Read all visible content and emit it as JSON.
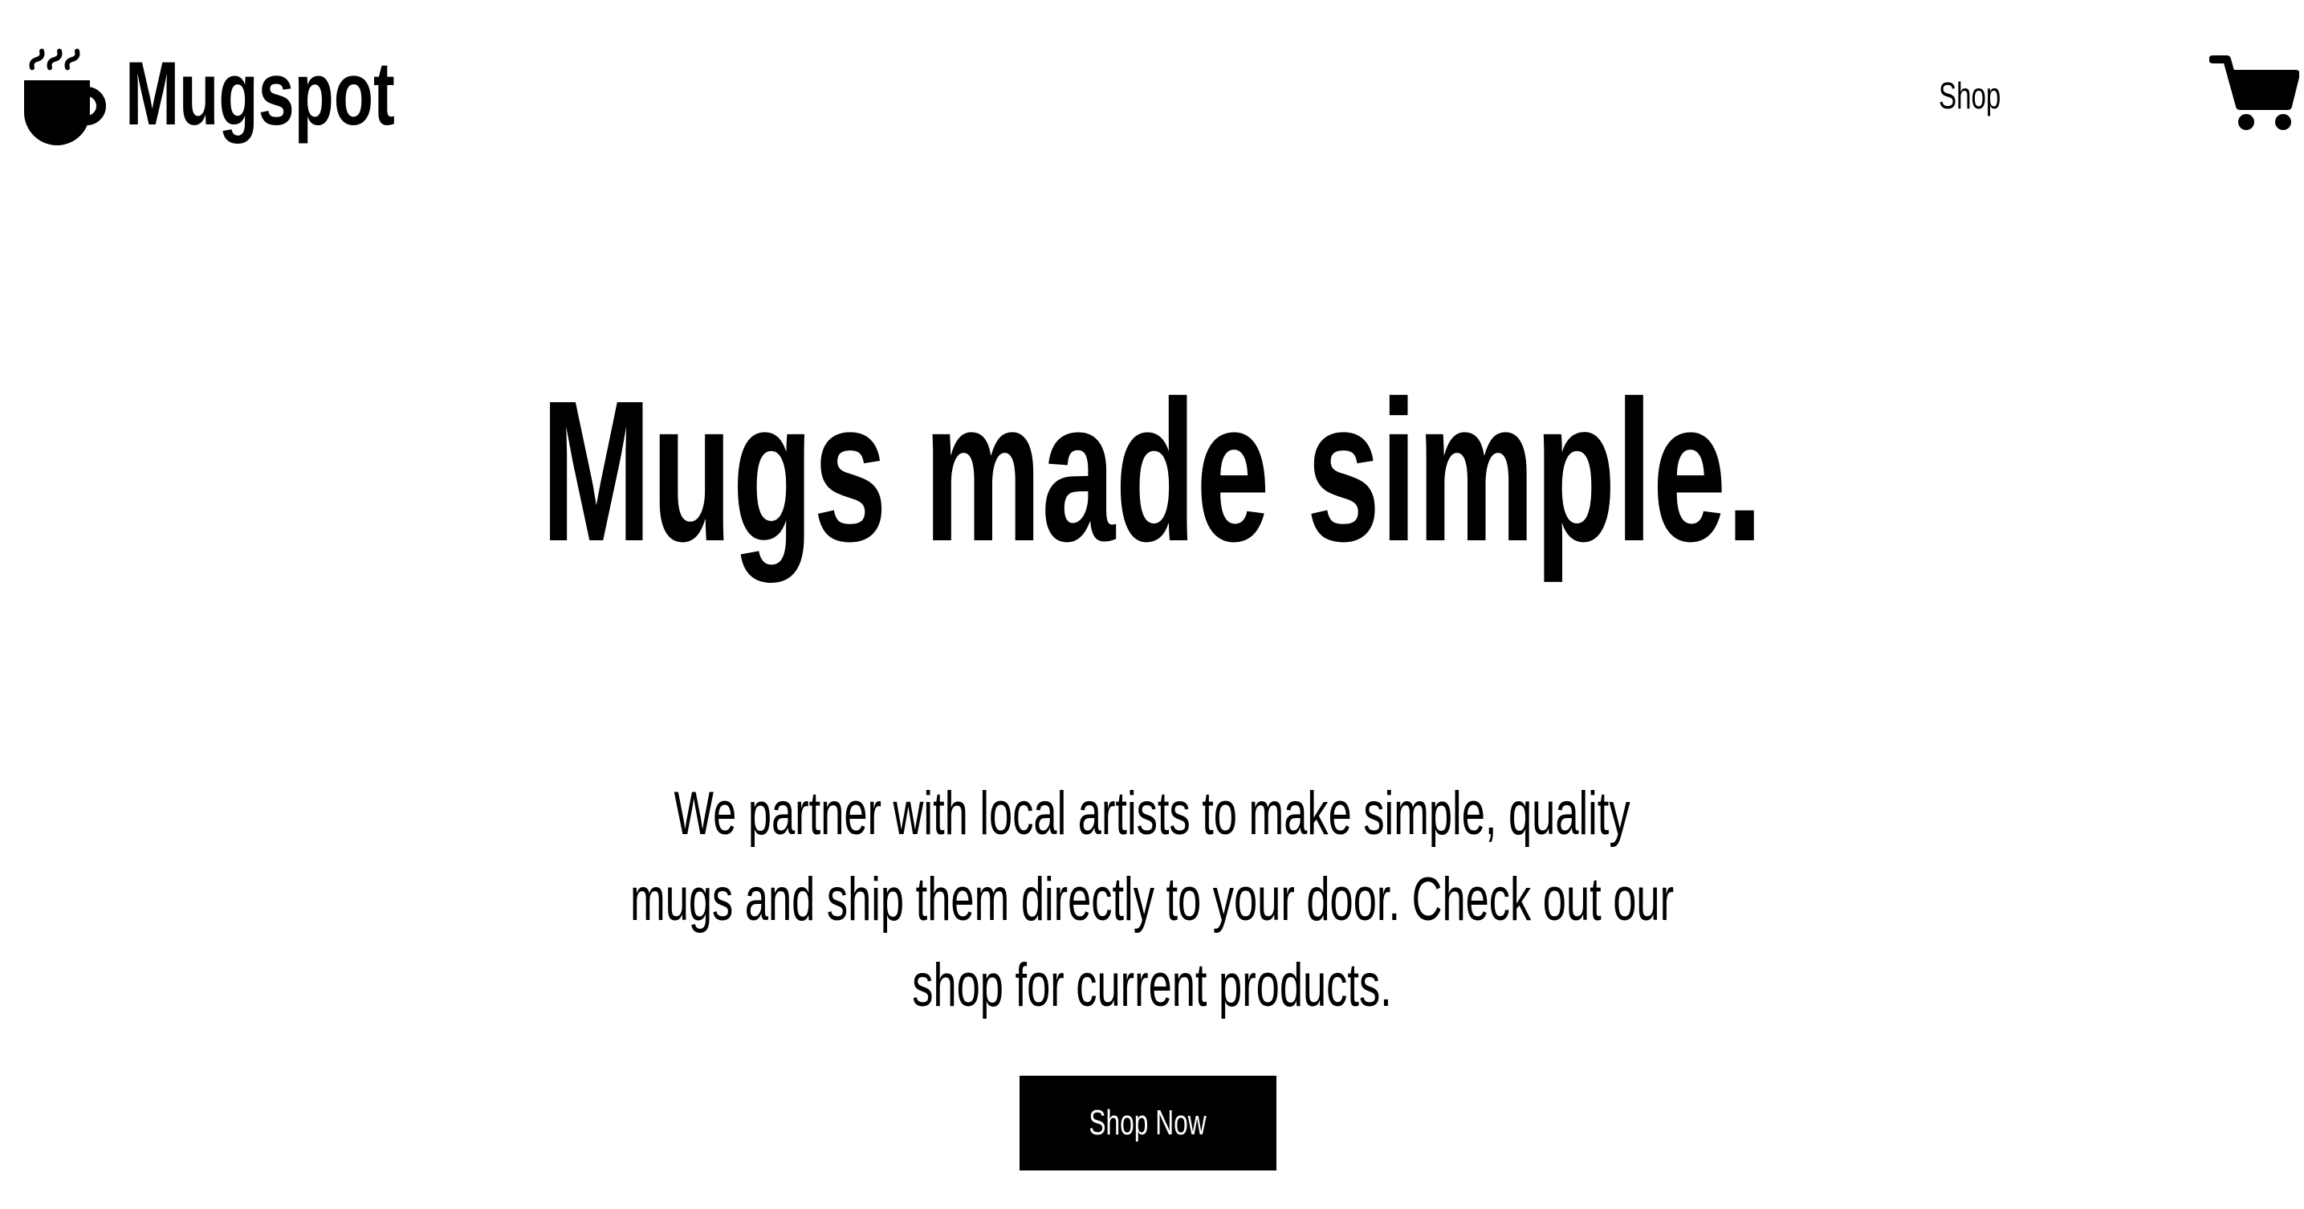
{
  "header": {
    "brand": "Mugspot",
    "logo_icon": "steaming-mug-icon",
    "nav": [
      {
        "label": "Shop"
      }
    ],
    "cart_icon": "shopping-cart-icon"
  },
  "hero": {
    "title": "Mugs made simple.",
    "description_lines": [
      "We partner with local artists to make simple, quality",
      "mugs and ship them directly to your door. Check out our",
      "shop for current products."
    ],
    "cta_label": "Shop Now"
  },
  "colors": {
    "background": "#ffffff",
    "text": "#000000",
    "button_bg": "#000000",
    "button_text": "#ffffff"
  }
}
